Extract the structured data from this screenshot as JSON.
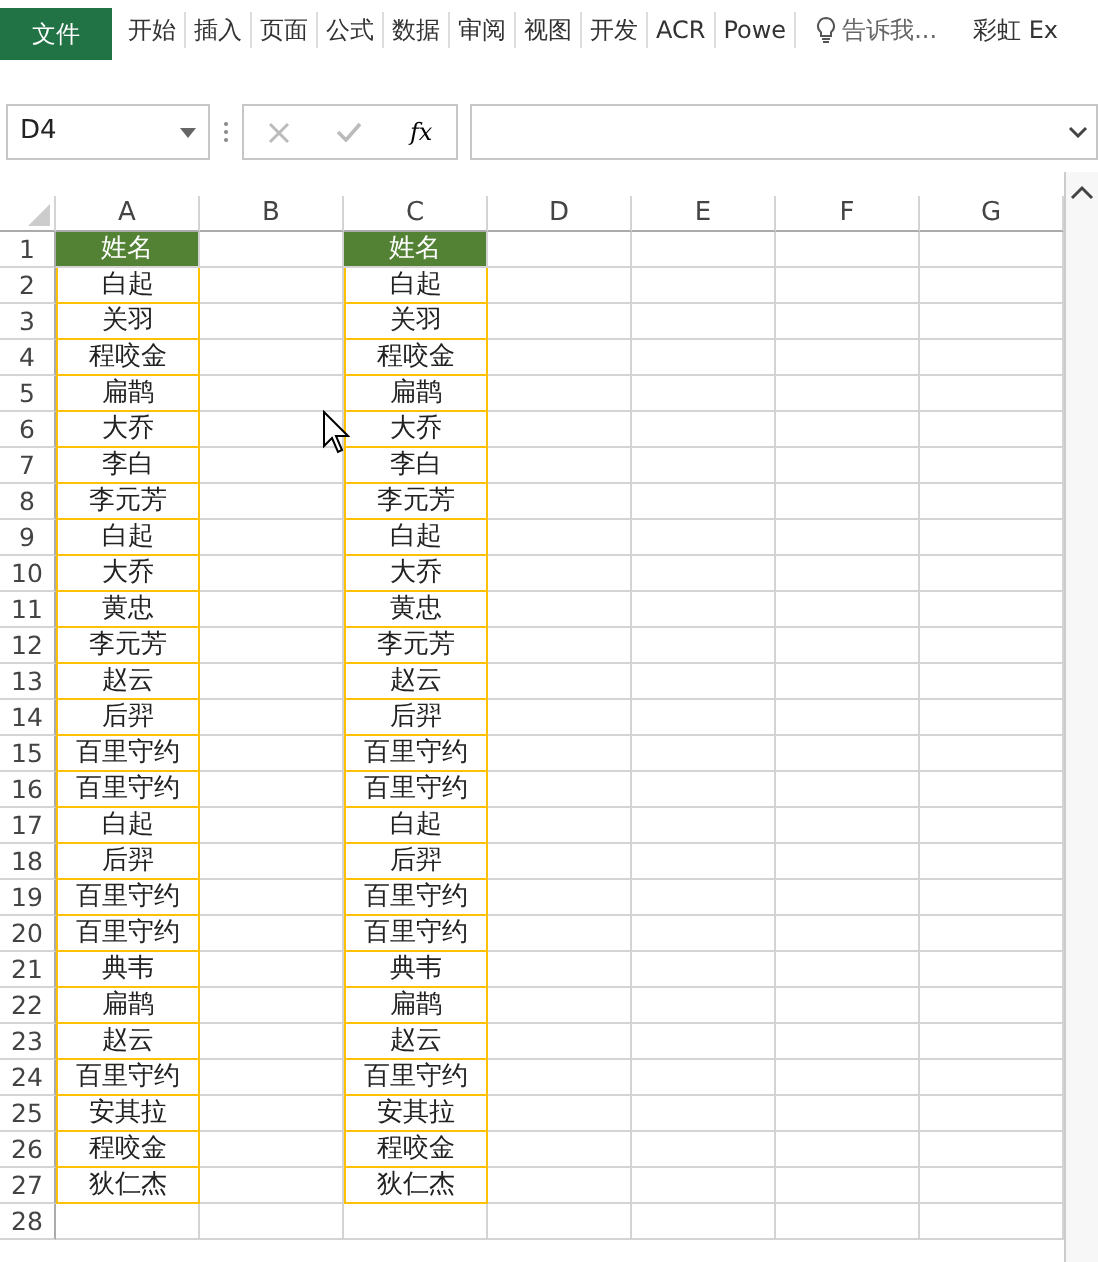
{
  "ribbon": {
    "tabs": [
      {
        "label": "文件",
        "kind": "file"
      },
      {
        "label": "开始",
        "kind": "tab"
      },
      {
        "label": "插入",
        "kind": "tab"
      },
      {
        "label": "页面",
        "kind": "tab"
      },
      {
        "label": "公式",
        "kind": "tab"
      },
      {
        "label": "数据",
        "kind": "tab"
      },
      {
        "label": "审阅",
        "kind": "tab"
      },
      {
        "label": "视图",
        "kind": "tab"
      },
      {
        "label": "开发",
        "kind": "tab"
      },
      {
        "label": "ACR",
        "kind": "tab"
      },
      {
        "label": "Powe",
        "kind": "tab"
      },
      {
        "label": "告诉我...",
        "kind": "tell"
      },
      {
        "label": "彩虹 Ex",
        "kind": "plain"
      }
    ]
  },
  "formula_bar": {
    "name_box": "D4",
    "function_label": "fx"
  },
  "sheet": {
    "columns": [
      "A",
      "B",
      "C",
      "D",
      "E",
      "F",
      "G"
    ],
    "rows": [
      {
        "number": "1",
        "kind": "header",
        "A": "姓名",
        "C": "姓名"
      },
      {
        "number": "2",
        "kind": "name",
        "A": "白起",
        "C": "白起"
      },
      {
        "number": "3",
        "kind": "name",
        "A": "关羽",
        "C": "关羽"
      },
      {
        "number": "4",
        "kind": "name",
        "A": "程咬金",
        "C": "程咬金"
      },
      {
        "number": "5",
        "kind": "name",
        "A": "扁鹊",
        "C": "扁鹊"
      },
      {
        "number": "6",
        "kind": "name",
        "A": "大乔",
        "C": "大乔"
      },
      {
        "number": "7",
        "kind": "name",
        "A": "李白",
        "C": "李白"
      },
      {
        "number": "8",
        "kind": "name",
        "A": "李元芳",
        "C": "李元芳"
      },
      {
        "number": "9",
        "kind": "name",
        "A": "白起",
        "C": "白起"
      },
      {
        "number": "10",
        "kind": "name",
        "A": "大乔",
        "C": "大乔"
      },
      {
        "number": "11",
        "kind": "name",
        "A": "黄忠",
        "C": "黄忠"
      },
      {
        "number": "12",
        "kind": "name",
        "A": "李元芳",
        "C": "李元芳"
      },
      {
        "number": "13",
        "kind": "name",
        "A": "赵云",
        "C": "赵云"
      },
      {
        "number": "14",
        "kind": "name",
        "A": "后羿",
        "C": "后羿"
      },
      {
        "number": "15",
        "kind": "name",
        "A": "百里守约",
        "C": "百里守约"
      },
      {
        "number": "16",
        "kind": "name",
        "A": "百里守约",
        "C": "百里守约"
      },
      {
        "number": "17",
        "kind": "name",
        "A": "白起",
        "C": "白起"
      },
      {
        "number": "18",
        "kind": "name",
        "A": "后羿",
        "C": "后羿"
      },
      {
        "number": "19",
        "kind": "name",
        "A": "百里守约",
        "C": "百里守约"
      },
      {
        "number": "20",
        "kind": "name",
        "A": "百里守约",
        "C": "百里守约"
      },
      {
        "number": "21",
        "kind": "name",
        "A": "典韦",
        "C": "典韦"
      },
      {
        "number": "22",
        "kind": "name",
        "A": "扁鹊",
        "C": "扁鹊"
      },
      {
        "number": "23",
        "kind": "name",
        "A": "赵云",
        "C": "赵云"
      },
      {
        "number": "24",
        "kind": "name",
        "A": "百里守约",
        "C": "百里守约"
      },
      {
        "number": "25",
        "kind": "name",
        "A": "安其拉",
        "C": "安其拉"
      },
      {
        "number": "26",
        "kind": "name",
        "A": "程咬金",
        "C": "程咬金"
      },
      {
        "number": "27",
        "kind": "name",
        "A": "狄仁杰",
        "C": "狄仁杰"
      },
      {
        "number": "28",
        "kind": "empty"
      }
    ]
  }
}
